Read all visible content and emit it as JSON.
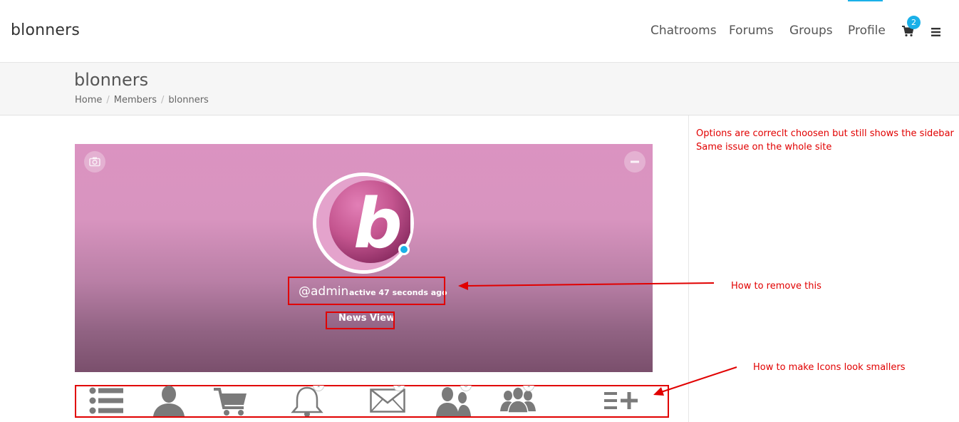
{
  "header": {
    "site_title": "blonners",
    "nav": [
      "Chatrooms",
      "Forums",
      "Groups",
      "Profile"
    ],
    "cart_count": "2",
    "accent_color": "#1ab0e8"
  },
  "titlebar": {
    "title": "blonners",
    "breadcrumbs": [
      "Home",
      "Members",
      "blonners"
    ],
    "separator": "/"
  },
  "profile": {
    "handle": "@admin",
    "activity": "active 47 seconds ago",
    "view_label": "News View",
    "avatar_letter": "b",
    "online_color": "#1ab0e8",
    "camera_icon": "camera-icon",
    "collapse_icon": "minus-icon"
  },
  "annotations": {
    "sidebar_note_1": "Options are correclt choosen but still shows the sidebar",
    "sidebar_note_2": "Same issue on the whole site",
    "remove_note": "How to remove this",
    "icons_note": "How to make Icons look smallers",
    "color": "#e10000"
  },
  "iconbar": {
    "items": [
      {
        "icon": "activity-list-icon",
        "count": ""
      },
      {
        "icon": "profile-icon",
        "count": ""
      },
      {
        "icon": "cart-icon",
        "count": ""
      },
      {
        "icon": "notifications-bell-icon",
        "count": "1"
      },
      {
        "icon": "messages-envelope-icon",
        "count": "0"
      },
      {
        "icon": "friends-icon",
        "count": "0"
      },
      {
        "icon": "groups-icon",
        "count": "1"
      },
      {
        "icon": "more-menu-icon",
        "count": ""
      }
    ],
    "icon_color": "#7a7a7a"
  }
}
